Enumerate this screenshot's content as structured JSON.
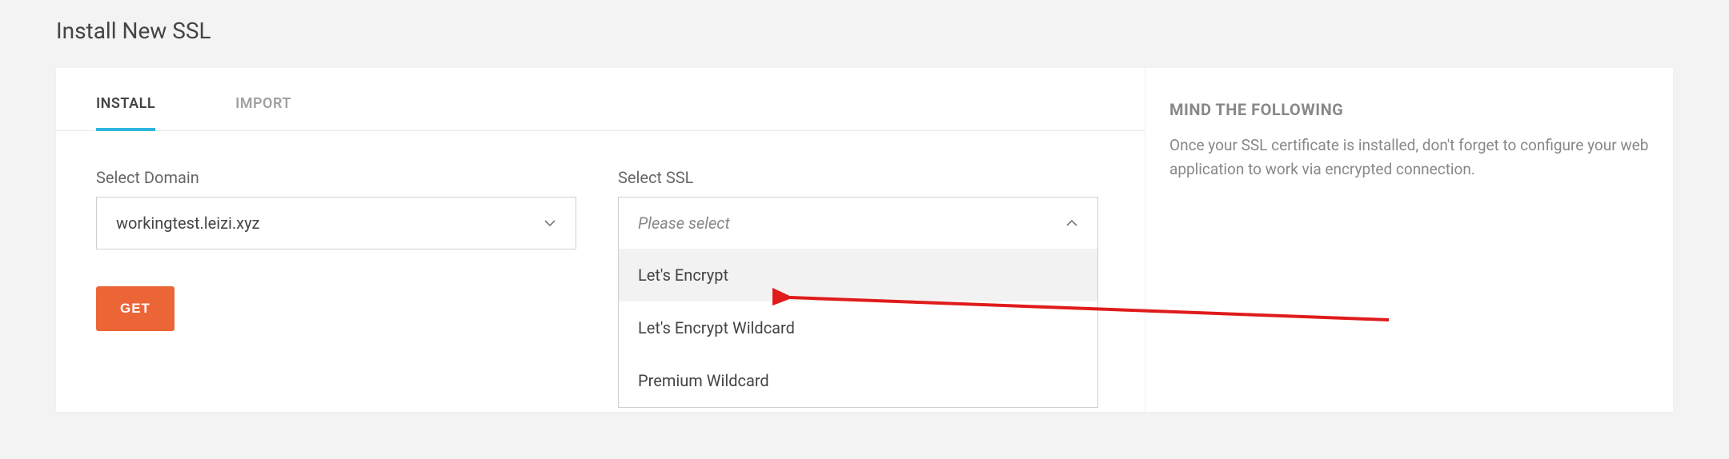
{
  "page": {
    "title": "Install New SSL"
  },
  "tabs": {
    "install": "INSTALL",
    "import": "IMPORT"
  },
  "form": {
    "domain_label": "Select Domain",
    "domain_value": "workingtest.leizi.xyz",
    "ssl_label": "Select SSL",
    "ssl_placeholder": "Please select",
    "ssl_options": {
      "0": "Let's Encrypt",
      "1": "Let's Encrypt Wildcard",
      "2": "Premium Wildcard"
    },
    "get_button": "GET"
  },
  "sidebar": {
    "heading": "MIND THE FOLLOWING",
    "body": "Once your SSL certificate is installed, don't forget to configure your web application to work via encrypted connection."
  }
}
